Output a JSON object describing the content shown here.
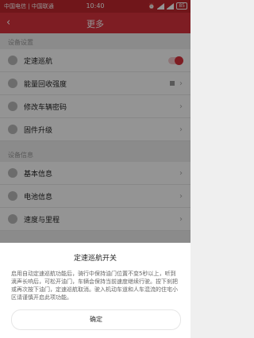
{
  "status": {
    "carriers": "中国电信 | 中国联通",
    "time": "10:40",
    "battery": "85"
  },
  "appbar": {
    "back_icon": "chevron-left-icon",
    "title": "更多"
  },
  "sections": [
    {
      "header": "设备设置",
      "items": [
        {
          "label": "定速巡航",
          "icon": "cruise-icon",
          "control": "toggle-on"
        },
        {
          "label": "能量回收强度",
          "icon": "energy-icon",
          "control": "chevron-with-indicator"
        },
        {
          "label": "修改车辆密码",
          "icon": "lock-icon",
          "control": "chevron"
        },
        {
          "label": "固件升级",
          "icon": "upgrade-icon",
          "control": "chevron"
        }
      ]
    },
    {
      "header": "设备信息",
      "items": [
        {
          "label": "基本信息",
          "icon": "info-icon",
          "control": "chevron"
        },
        {
          "label": "电池信息",
          "icon": "battery-icon",
          "control": "chevron"
        },
        {
          "label": "速度与里程",
          "icon": "speed-icon",
          "control": "chevron"
        }
      ]
    }
  ],
  "dialog": {
    "title": "定速巡航开关",
    "body": "启用自动定速巡航功能后，骑行中保持油门位置不变5秒以上，听到滴声长响后，可松开油门，车辆会保持当前速度继续行驶。捏下刹把或再次按下油门，定速巡航取消。驶入机动车道和人车混流的住宅小区请谨慎开启此项功能。",
    "ok_label": "确定"
  },
  "colors": {
    "accent": "#d9333d",
    "status_bar": "#c1272d"
  }
}
